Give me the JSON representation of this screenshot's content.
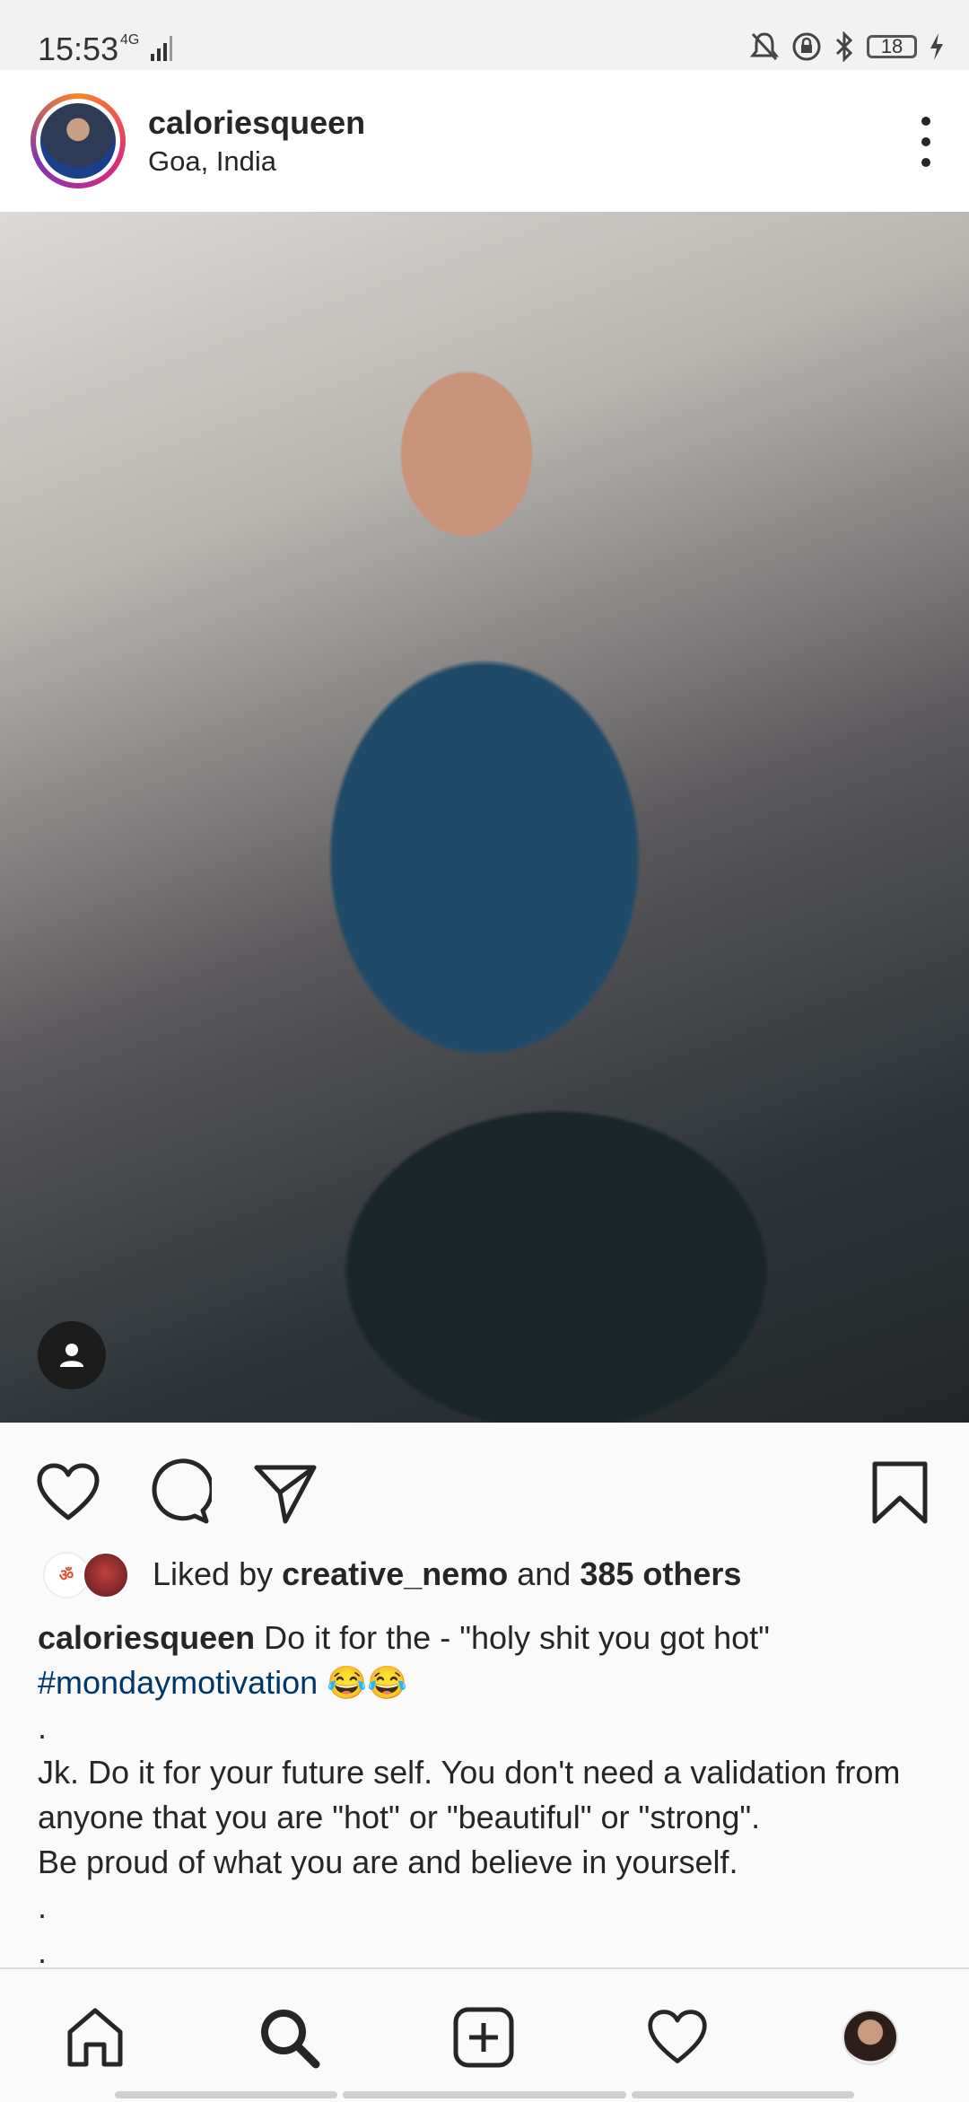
{
  "status_bar": {
    "time": "15:53",
    "network": "4G",
    "battery": "18",
    "icons": [
      "silent-bell-icon",
      "rotation-lock-icon",
      "bluetooth-icon",
      "battery-icon",
      "charging-icon"
    ]
  },
  "post": {
    "username": "caloriesqueen",
    "location": "Goa, India",
    "likes": {
      "prefix": "Liked by",
      "first_liker": "creative_nemo",
      "connector": "and",
      "others": "385 others"
    },
    "caption": {
      "username": "caloriesqueen",
      "text": "Do it for the - \"holy shit you got hot\"",
      "hashtag": "#mondaymotivation",
      "emoji": "😂😂",
      "dot1": ".",
      "line1": "Jk. Do it for your future self. You don't need a validation from anyone that you are \"hot\" or \"beautiful\" or \"strong\".",
      "line2": "Be proud of what you are and believe in yourself.",
      "dot2": ".",
      "dot3": "."
    }
  },
  "actions": [
    "heart-icon",
    "comment-icon",
    "share-icon",
    "bookmark-icon"
  ],
  "bottom_nav": [
    "home-icon",
    "search-icon",
    "add-post-icon",
    "activity-heart-icon",
    "profile-avatar"
  ],
  "colors": {
    "hashtag": "#00376b",
    "text": "#262626",
    "background": "#fafafa"
  }
}
